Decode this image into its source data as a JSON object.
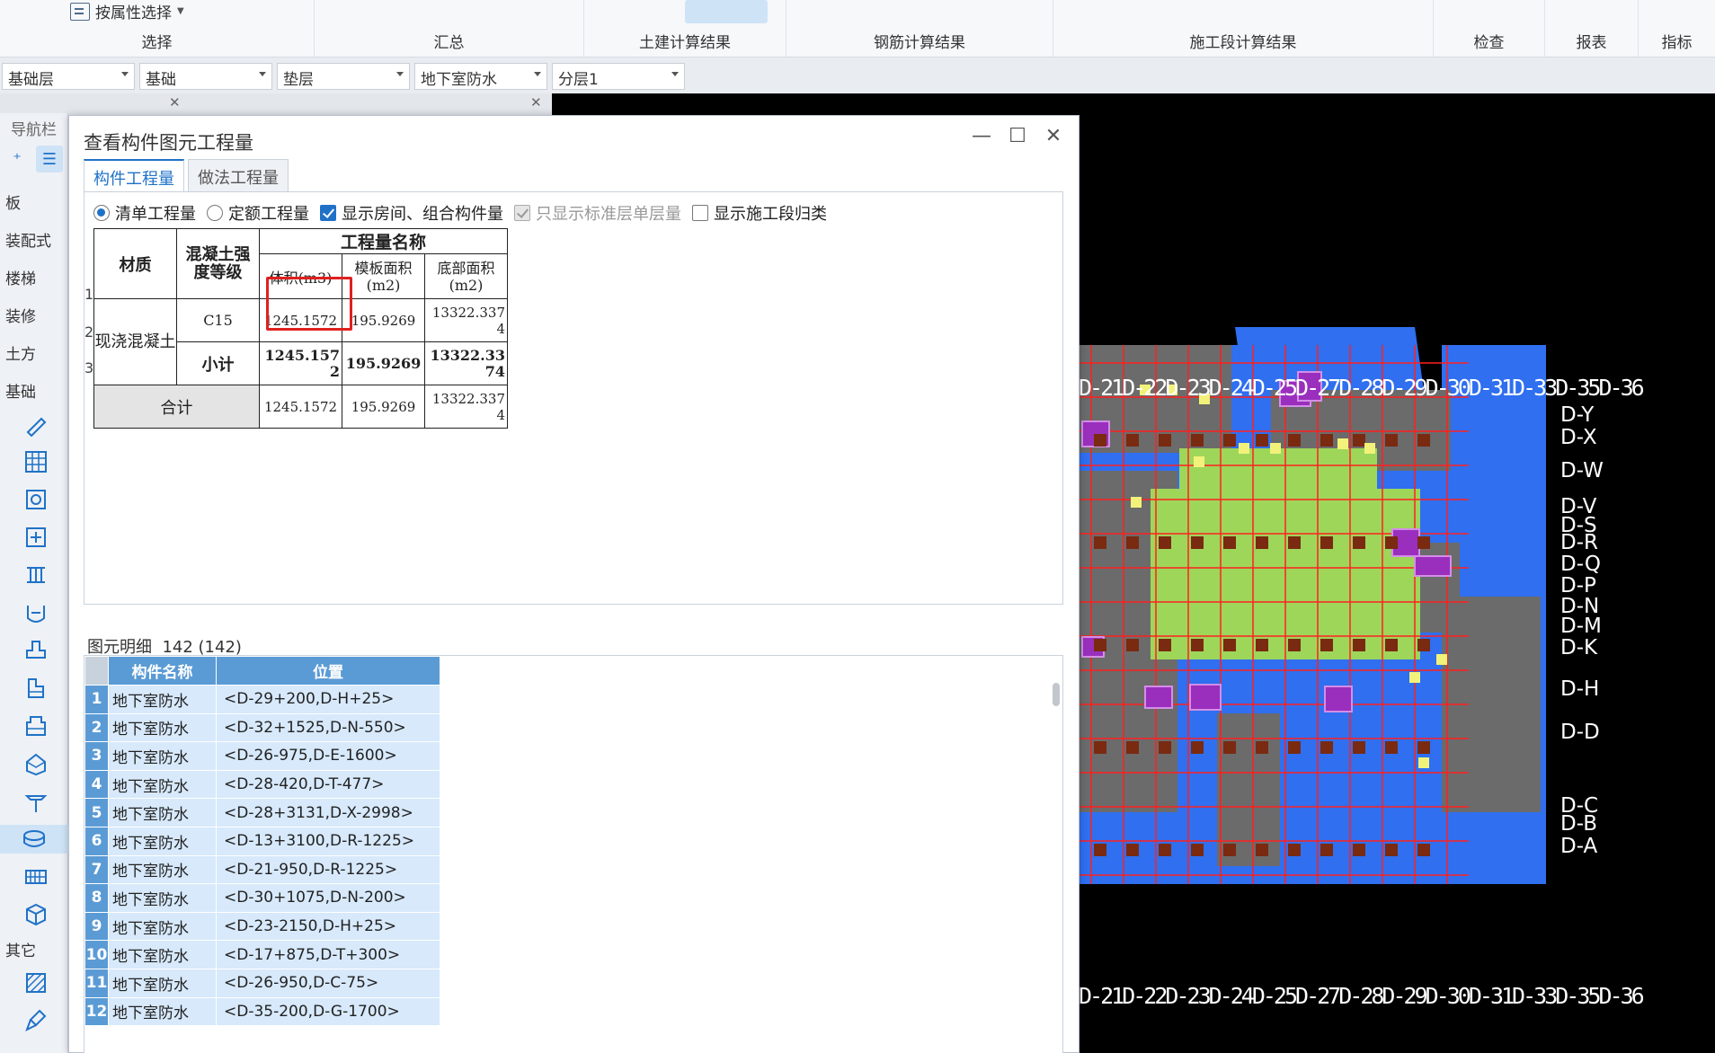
{
  "ribbon": {
    "groups": [
      {
        "label": "选择"
      },
      {
        "label": "汇总"
      },
      {
        "label": "土建计算结果"
      },
      {
        "label": "钢筋计算结果"
      },
      {
        "label": "施工段计算结果"
      },
      {
        "label": "检查"
      },
      {
        "label": "报表"
      },
      {
        "label": "指标"
      }
    ],
    "attr_select": "按属性选择"
  },
  "selectors": [
    "基础层",
    "基础",
    "垫层",
    "地下室防水",
    "分层1"
  ],
  "nav": {
    "title": "导航栏",
    "categories": [
      "板",
      "装配式",
      "楼梯",
      "装修",
      "土方",
      "基础",
      "其它"
    ]
  },
  "dialog": {
    "title": "查看构件图元工程量",
    "tabs": [
      "构件工程量",
      "做法工程量"
    ],
    "options": {
      "list_qty": "清单工程量",
      "quota_qty": "定额工程量",
      "show_rooms": "显示房间、组合构件量",
      "std_floor_only": "只显示标准层单层量",
      "show_stage": "显示施工段归类"
    },
    "qty_table": {
      "h_material": "材质",
      "h_grade": "混凝土强度等级",
      "h_group": "工程量名称",
      "h_volume": "体积(m3)",
      "h_formwork": "模板面积(m2)",
      "h_bottom": "底部面积(m2)",
      "rows": [
        {
          "num": "1",
          "material": "现浇混凝土",
          "grade": "C15",
          "volume": "1245.1572",
          "formwork": "195.9269",
          "bottom": "13322.3374"
        },
        {
          "num": "2",
          "grade": "小计",
          "volume": "1245.1572",
          "formwork": "195.9269",
          "bottom": "13322.3374"
        },
        {
          "num": "3",
          "material": "合计",
          "volume": "1245.1572",
          "formwork": "195.9269",
          "bottom": "13322.3374"
        }
      ]
    },
    "detail": {
      "label": "图元明细",
      "count": "142 (142)",
      "h_name": "构件名称",
      "h_pos": "位置",
      "rows": [
        {
          "i": "1",
          "name": "地下室防水",
          "pos": "<D-29+200,D-H+25>"
        },
        {
          "i": "2",
          "name": "地下室防水",
          "pos": "<D-32+1525,D-N-550>"
        },
        {
          "i": "3",
          "name": "地下室防水",
          "pos": "<D-26-975,D-E-1600>"
        },
        {
          "i": "4",
          "name": "地下室防水",
          "pos": "<D-28-420,D-T-477>"
        },
        {
          "i": "5",
          "name": "地下室防水",
          "pos": "<D-28+3131,D-X-2998>"
        },
        {
          "i": "6",
          "name": "地下室防水",
          "pos": "<D-13+3100,D-R-1225>"
        },
        {
          "i": "7",
          "name": "地下室防水",
          "pos": "<D-21-950,D-R-1225>"
        },
        {
          "i": "8",
          "name": "地下室防水",
          "pos": "<D-30+1075,D-N-200>"
        },
        {
          "i": "9",
          "name": "地下室防水",
          "pos": "<D-23-2150,D-H+25>"
        },
        {
          "i": "10",
          "name": "地下室防水",
          "pos": "<D-17+875,D-T+300>"
        },
        {
          "i": "11",
          "name": "地下室防水",
          "pos": "<D-26-950,D-C-75>"
        },
        {
          "i": "12",
          "name": "地下室防水",
          "pos": "<D-35-200,D-G-1700>"
        }
      ]
    }
  },
  "canvas": {
    "axis_labels_right": [
      "D-Y",
      "D-X",
      "D-W",
      "D-V",
      "D-S",
      "D-R",
      "D-Q",
      "D-P",
      "D-N",
      "D-M",
      "D-K",
      "D-H",
      "D-D",
      "D-C",
      "D-B",
      "D-A"
    ],
    "top_labels": "D-21D-22D-23D-24D-25D-27D-28D-29D-30D-31D-33D-35D-36",
    "bottom_labels": "D-21D-22D-23D-24D-25D-27D-28D-29D-30D-31D-33D-35D-36"
  }
}
